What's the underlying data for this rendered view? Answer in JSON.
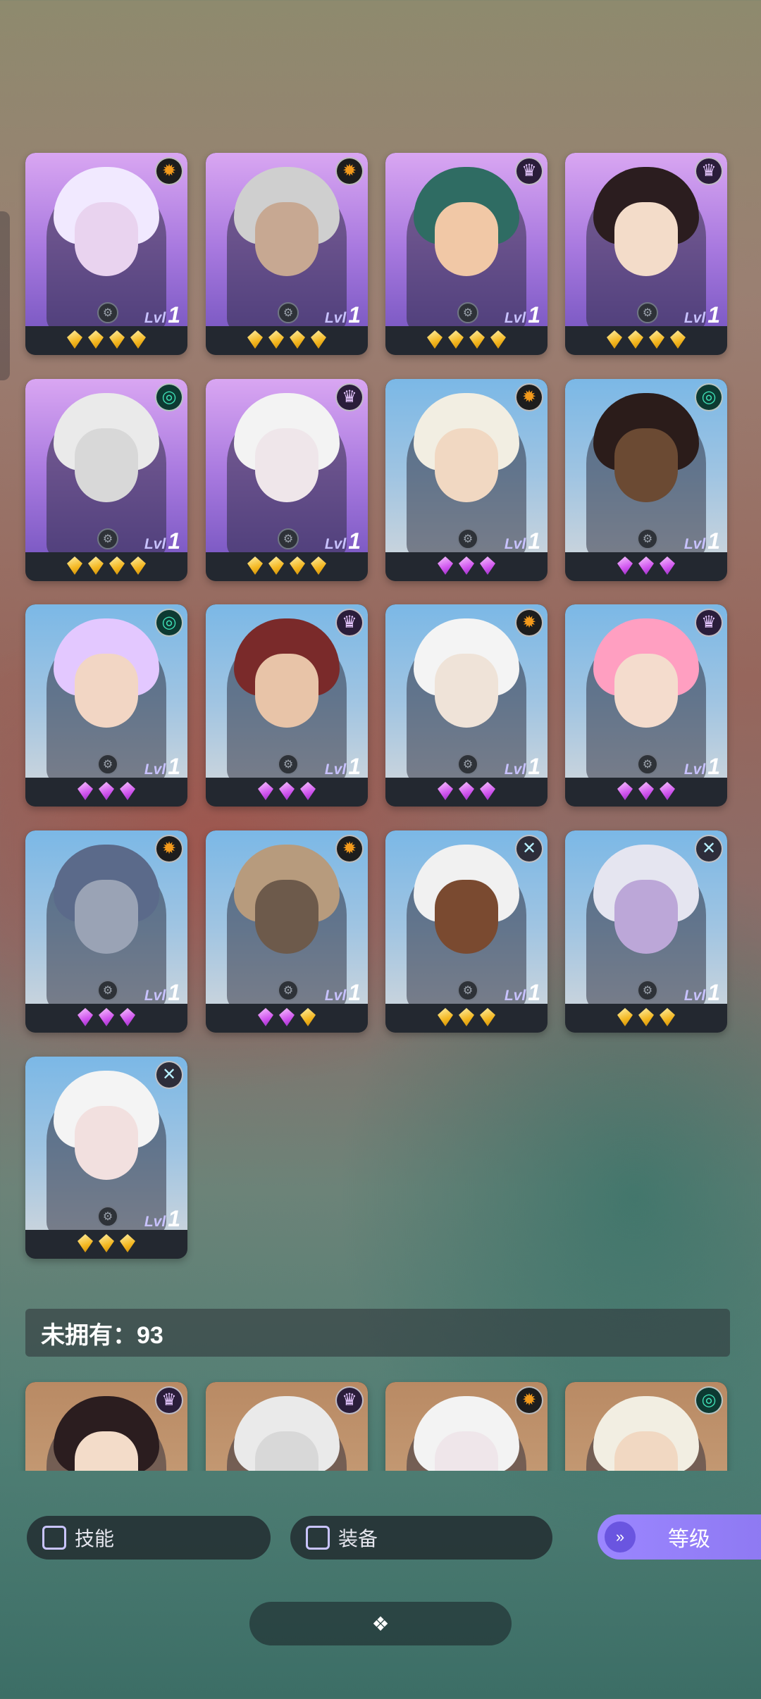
{
  "owned_heroes": [
    {
      "faction": "sun",
      "level_label": "Lvl",
      "level": "1",
      "gems": [
        "gold",
        "gold",
        "gold",
        "gold"
      ],
      "bg": "purple"
    },
    {
      "faction": "sun",
      "level_label": "Lvl",
      "level": "1",
      "gems": [
        "gold",
        "gold",
        "gold",
        "gold"
      ],
      "bg": "purple"
    },
    {
      "faction": "dark",
      "level_label": "Lvl",
      "level": "1",
      "gems": [
        "gold",
        "gold",
        "gold",
        "gold"
      ],
      "bg": "purple"
    },
    {
      "faction": "dark",
      "level_label": "Lvl",
      "level": "1",
      "gems": [
        "gold",
        "gold",
        "gold",
        "gold"
      ],
      "bg": "purple"
    },
    {
      "faction": "nature",
      "level_label": "Lvl",
      "level": "1",
      "gems": [
        "gold",
        "gold",
        "gold",
        "gold"
      ],
      "bg": "purple"
    },
    {
      "faction": "dark",
      "level_label": "Lvl",
      "level": "1",
      "gems": [
        "gold",
        "gold",
        "gold",
        "gold"
      ],
      "bg": "purple"
    },
    {
      "faction": "sun",
      "level_label": "Lvl",
      "level": "1",
      "gems": [
        "purple",
        "purple",
        "purple"
      ],
      "bg": "blue"
    },
    {
      "faction": "nature",
      "level_label": "Lvl",
      "level": "1",
      "gems": [
        "purple",
        "purple",
        "purple"
      ],
      "bg": "blue"
    },
    {
      "faction": "nature",
      "level_label": "Lvl",
      "level": "1",
      "gems": [
        "purple",
        "purple",
        "purple"
      ],
      "bg": "blue"
    },
    {
      "faction": "dark",
      "level_label": "Lvl",
      "level": "1",
      "gems": [
        "purple",
        "purple",
        "purple"
      ],
      "bg": "blue"
    },
    {
      "faction": "sun",
      "level_label": "Lvl",
      "level": "1",
      "gems": [
        "purple",
        "purple",
        "purple"
      ],
      "bg": "blue"
    },
    {
      "faction": "dark",
      "level_label": "Lvl",
      "level": "1",
      "gems": [
        "purple",
        "purple",
        "purple"
      ],
      "bg": "blue"
    },
    {
      "faction": "sun",
      "level_label": "Lvl",
      "level": "1",
      "gems": [
        "purple",
        "purple",
        "purple"
      ],
      "bg": "blue"
    },
    {
      "faction": "sun",
      "level_label": "Lvl",
      "level": "1",
      "gems": [
        "purple",
        "purple",
        "gold"
      ],
      "bg": "blue"
    },
    {
      "faction": "arcane",
      "level_label": "Lvl",
      "level": "1",
      "gems": [
        "gold",
        "gold",
        "gold"
      ],
      "bg": "blue"
    },
    {
      "faction": "arcane",
      "level_label": "Lvl",
      "level": "1",
      "gems": [
        "gold",
        "gold",
        "gold"
      ],
      "bg": "blue"
    },
    {
      "faction": "arcane",
      "level_label": "Lvl",
      "level": "1",
      "gems": [
        "gold",
        "gold",
        "gold"
      ],
      "bg": "blue"
    }
  ],
  "unowned": {
    "label": "未拥有：93"
  },
  "unowned_heroes": [
    {
      "faction": "dark",
      "bg": "warm"
    },
    {
      "faction": "dark",
      "bg": "warm"
    },
    {
      "faction": "sun",
      "bg": "warm"
    },
    {
      "faction": "nature",
      "bg": "warm"
    }
  ],
  "faction_icons": {
    "sun": "✹",
    "dark": "♛",
    "nature": "◎",
    "arcane": "✕"
  },
  "filters": {
    "skill": "技能",
    "equipment": "装备"
  },
  "sort": {
    "label": "等级",
    "icon": "»"
  },
  "collapse_icon": "❖"
}
